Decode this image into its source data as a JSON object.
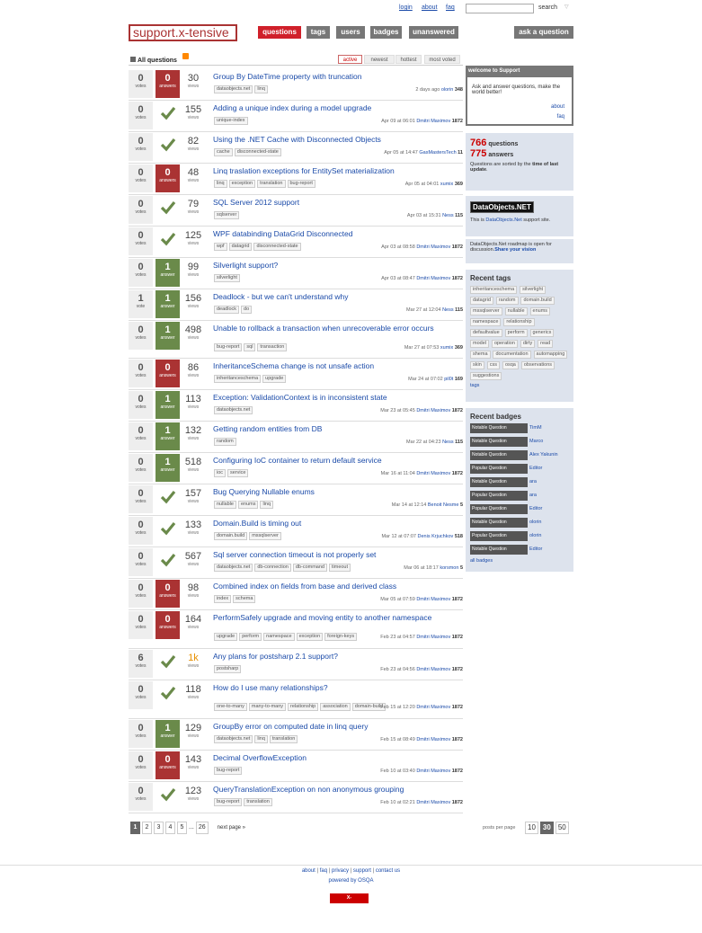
{
  "toplinks": [
    "login",
    "about",
    "faq"
  ],
  "search": {
    "label": "search",
    "placeholder": ""
  },
  "logo": "support.x-tensive",
  "nav": [
    "questions",
    "tags",
    "users",
    "badges",
    "unanswered"
  ],
  "ask_label": "ask a question",
  "list_header": "All questions",
  "sort_tabs": [
    "active",
    "newest",
    "hottest",
    "most voted"
  ],
  "labels": {
    "votes": "votes",
    "vote": "vote",
    "answers": "answers",
    "answer": "answer",
    "views": "views"
  },
  "questions": [
    {
      "votes": "0",
      "vl": "votes",
      "answers": "0",
      "al": "answers",
      "accepted": false,
      "views": "30",
      "title": "Group By DateTime property with truncation",
      "tags": [
        "dataobjects.net",
        "linq"
      ],
      "when": "2 days ago",
      "user": "olorin",
      "rep": "348"
    },
    {
      "votes": "0",
      "vl": "votes",
      "answers": "",
      "al": "",
      "accepted": true,
      "views": "155",
      "title": "Adding a unique index during a model upgrade",
      "tags": [
        "unique-index"
      ],
      "when": "Apr 09 at 06:01",
      "user": "Dmitri Maximov",
      "rep": "1872"
    },
    {
      "votes": "0",
      "vl": "votes",
      "answers": "",
      "al": "",
      "accepted": true,
      "views": "82",
      "title": "Using the .NET Cache with Disconnected Objects",
      "tags": [
        "cache",
        "disconnected-state"
      ],
      "when": "Apr 05 at 14:47",
      "user": "GasMastersTech",
      "rep": "11"
    },
    {
      "votes": "0",
      "vl": "votes",
      "answers": "0",
      "al": "answers",
      "accepted": false,
      "views": "48",
      "title": "Linq traslation exceptions for EntitySet materialization",
      "tags": [
        "linq",
        "exception",
        "translation",
        "bug-report"
      ],
      "when": "Apr 05 at 04:01",
      "user": "xumix",
      "rep": "369"
    },
    {
      "votes": "0",
      "vl": "votes",
      "answers": "",
      "al": "",
      "accepted": true,
      "views": "79",
      "title": "SQL Server 2012 support",
      "tags": [
        "sqlserver"
      ],
      "when": "Apr 03 at 15:31",
      "user": "Ness",
      "rep": "115"
    },
    {
      "votes": "0",
      "vl": "votes",
      "answers": "",
      "al": "",
      "accepted": true,
      "views": "125",
      "title": "WPF databinding DataGrid Disconnected",
      "tags": [
        "wpf",
        "datagrid",
        "disconnected-state"
      ],
      "when": "Apr 03 at 08:58",
      "user": "Dmitri Maximov",
      "rep": "1872"
    },
    {
      "votes": "0",
      "vl": "votes",
      "answers": "1",
      "al": "answer",
      "accepted": false,
      "views": "99",
      "title": "Silverlight support?",
      "tags": [
        "silverlight"
      ],
      "when": "Apr 03 at 08:47",
      "user": "Dmitri Maximov",
      "rep": "1872"
    },
    {
      "votes": "1",
      "vl": "vote",
      "answers": "1",
      "al": "answer",
      "accepted": false,
      "views": "156",
      "title": "Deadlock - but we can't understand why",
      "tags": [
        "deadlock",
        "do"
      ],
      "when": "Mar 27 at 12:04",
      "user": "Ness",
      "rep": "115"
    },
    {
      "votes": "0",
      "vl": "votes",
      "answers": "1",
      "al": "answer",
      "accepted": false,
      "views": "498",
      "title": "Unable to rollback a transaction when unrecoverable error occurs",
      "tags": [
        "bug-report",
        "sql",
        "transaction"
      ],
      "when": "Mar 27 at 07:53",
      "user": "xumix",
      "rep": "369"
    },
    {
      "votes": "0",
      "vl": "votes",
      "answers": "0",
      "al": "answers",
      "accepted": false,
      "views": "86",
      "title": "InheritanceSchema change is not unsafe action",
      "tags": [
        "inheritanceschema",
        "upgrade"
      ],
      "when": "Mar 24 at 07:02",
      "user": "pil0t",
      "rep": "169"
    },
    {
      "votes": "0",
      "vl": "votes",
      "answers": "1",
      "al": "answer",
      "accepted": false,
      "views": "113",
      "title": "Exception: ValidationContext is in inconsistent state",
      "tags": [
        "dataobjects.net"
      ],
      "when": "Mar 23 at 05:45",
      "user": "Dmitri Maximov",
      "rep": "1872"
    },
    {
      "votes": "0",
      "vl": "votes",
      "answers": "1",
      "al": "answer",
      "accepted": false,
      "views": "132",
      "title": "Getting random entities from DB",
      "tags": [
        "random"
      ],
      "when": "Mar 22 at 04:23",
      "user": "Ness",
      "rep": "115"
    },
    {
      "votes": "0",
      "vl": "votes",
      "answers": "1",
      "al": "answer",
      "accepted": false,
      "views": "518",
      "title": "Configuring IoC container to return default service",
      "tags": [
        "ioc",
        "service"
      ],
      "when": "Mar 16 at 11:04",
      "user": "Dmitri Maximov",
      "rep": "1872"
    },
    {
      "votes": "0",
      "vl": "votes",
      "answers": "",
      "al": "",
      "accepted": true,
      "views": "157",
      "title": "Bug Querying Nullable enums",
      "tags": [
        "nullable",
        "enums",
        "linq"
      ],
      "when": "Mar 14 at 12:14",
      "user": "Benoit Nesme",
      "rep": "5"
    },
    {
      "votes": "0",
      "vl": "votes",
      "answers": "",
      "al": "",
      "accepted": true,
      "views": "133",
      "title": "Domain.Build is timing out",
      "tags": [
        "domain.build",
        "mssqlserver"
      ],
      "when": "Mar 12 at 07:07",
      "user": "Denis Krjuchkov",
      "rep": "518"
    },
    {
      "votes": "0",
      "vl": "votes",
      "answers": "",
      "al": "",
      "accepted": true,
      "views": "567",
      "title": "Sql server connection timeout is not properly set",
      "tags": [
        "dataobjects.net",
        "db-connection",
        "db-command",
        "timeout"
      ],
      "when": "Mar 06 at 18:17",
      "user": "korsmon",
      "rep": "5"
    },
    {
      "votes": "0",
      "vl": "votes",
      "answers": "0",
      "al": "answers",
      "accepted": false,
      "views": "98",
      "title": "Combined index on fields from base and derived class",
      "tags": [
        "index",
        "schema"
      ],
      "when": "Mar 05 at 07:59",
      "user": "Dmitri Maximov",
      "rep": "1872"
    },
    {
      "votes": "0",
      "vl": "votes",
      "answers": "0",
      "al": "answers",
      "accepted": false,
      "views": "164",
      "title": "PerformSafely upgrade and moving entity to another namespace",
      "tags": [
        "upgrade",
        "perform",
        "namespace",
        "exception",
        "foreign-keys"
      ],
      "when": "Feb 23 at 04:57",
      "user": "Dmitri Maximov",
      "rep": "1872"
    },
    {
      "votes": "6",
      "vl": "votes",
      "answers": "",
      "al": "",
      "accepted": true,
      "views": "1k",
      "hot": true,
      "title": "Any plans for postsharp 2.1 support?",
      "tags": [
        "postsharp"
      ],
      "when": "Feb 23 at 04:56",
      "user": "Dmitri Maximov",
      "rep": "1872"
    },
    {
      "votes": "0",
      "vl": "votes",
      "answers": "",
      "al": "",
      "accepted": true,
      "views": "118",
      "title": "How do I use many relationships?",
      "tags": [
        "one-to-many",
        "many-to-many",
        "relationship",
        "association",
        "domain-build"
      ],
      "when": "Feb 15 at 12:20",
      "user": "Dmitri Maximov",
      "rep": "1872"
    },
    {
      "votes": "0",
      "vl": "votes",
      "answers": "1",
      "al": "answer",
      "accepted": false,
      "views": "129",
      "title": "GroupBy error on computed date in linq query",
      "tags": [
        "dataobjects.net",
        "linq",
        "translation"
      ],
      "when": "Feb 15 at 08:49",
      "user": "Dmitri Maximov",
      "rep": "1872"
    },
    {
      "votes": "0",
      "vl": "votes",
      "answers": "0",
      "al": "answers",
      "accepted": false,
      "views": "143",
      "title": "Decimal OverflowException",
      "tags": [
        "bug-report"
      ],
      "when": "Feb 10 at 03:40",
      "user": "Dmitri Maximov",
      "rep": "1872"
    },
    {
      "votes": "0",
      "vl": "votes",
      "answers": "",
      "al": "",
      "accepted": true,
      "views": "123",
      "title": "QueryTranslationException on non anonymous grouping",
      "tags": [
        "bug-report",
        "translation"
      ],
      "when": "Feb 10 at 02:21",
      "user": "Dmitri Maximov",
      "rep": "1872"
    }
  ],
  "sidebar": {
    "welcome_title": "welcome to Support",
    "welcome_text": "Ask and answer questions, make the world better!",
    "about": "about",
    "faq": "faq",
    "q_count": "766",
    "q_label": "questions",
    "a_count": "775",
    "a_label": "answers",
    "sort_note_a": "Questions are sorted by the ",
    "sort_note_b": "time of last update",
    "sort_note_c": ".",
    "do_logo": "DataObjects.NET",
    "do_text_a": "This is ",
    "do_text_link": "DataObjects.Net",
    "do_text_b": " support site.",
    "roadmap_a": "DataObjects.Net roadmap is open for discussion.",
    "roadmap_link": "Share your vision",
    "recent_tags_title": "Recent tags",
    "recent_tags": [
      "inheritanceschema",
      "silverlight",
      "datagrid",
      "random",
      "domain.build",
      "mssqlserver",
      "nullable",
      "enums",
      "namespace",
      "relationship",
      "defaultvalue",
      "perform",
      "generics",
      "model",
      "operation",
      "dirty",
      "read",
      "shema",
      "documentation",
      "automapping",
      "skin",
      "css",
      "osqa",
      "observations",
      "suggestions"
    ],
    "tags_link": "tags",
    "recent_badges_title": "Recent badges",
    "badges": [
      {
        "badge": "Notable Question",
        "user": "TimM"
      },
      {
        "badge": "Notable Question",
        "user": "Marco"
      },
      {
        "badge": "Notable Question",
        "user": "Alex Yakunin"
      },
      {
        "badge": "Popular Question",
        "user": "Editor"
      },
      {
        "badge": "Notable Question",
        "user": "ara"
      },
      {
        "badge": "Popular Question",
        "user": "ara"
      },
      {
        "badge": "Popular Question",
        "user": "Editor"
      },
      {
        "badge": "Notable Question",
        "user": "olorin"
      },
      {
        "badge": "Popular Question",
        "user": "olorin"
      },
      {
        "badge": "Notable Question",
        "user": "Editor"
      }
    ],
    "all_badges": "all badges"
  },
  "pager": {
    "pages": [
      "1",
      "2",
      "3",
      "4",
      "5",
      "...",
      "26"
    ],
    "next": "next page »",
    "per_page_label": "posts per page",
    "sizes": [
      "10",
      "30",
      "50"
    ]
  },
  "footer": {
    "links": [
      "about",
      "faq",
      "privacy",
      "support",
      "contact us"
    ],
    "powered": "powered by OSQA",
    "logo": "X-TENSIVE.COM"
  }
}
